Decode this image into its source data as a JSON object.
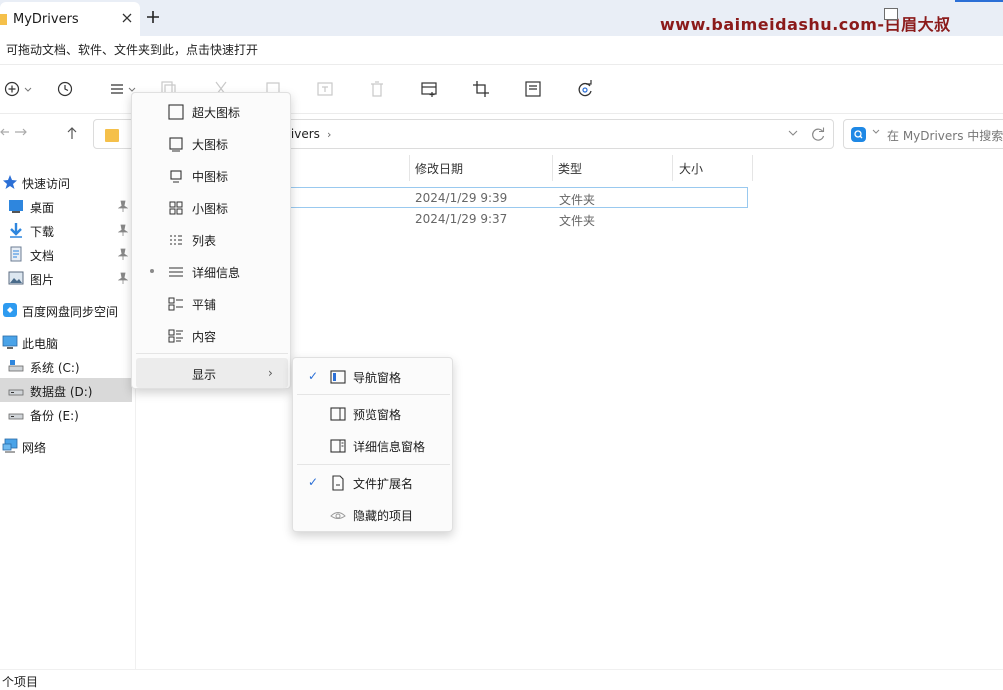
{
  "tab": {
    "title": "MyDrivers"
  },
  "watermark": "www.baimeidashu.com-白眉大叔",
  "hint": "可拖动文档、软件、文件夹到此，点击快速打开",
  "address": {
    "path_tail": "rivers",
    "separator": "›"
  },
  "search": {
    "placeholder": "在 MyDrivers 中搜索"
  },
  "nav": {
    "quick_access": "快速访问",
    "desktop": "桌面",
    "downloads": "下载",
    "documents": "文档",
    "pictures": "图片",
    "baidu": "百度网盘同步空间",
    "this_pc": "此电脑",
    "system_drive": "系统 (C:)",
    "data_drive": "数据盘 (D:)",
    "backup_drive": "备份 (E:)",
    "network": "网络"
  },
  "columns": {
    "modified": "修改日期",
    "type": "类型",
    "size": "大小"
  },
  "rows": [
    {
      "modified": "2024/1/29 9:39",
      "type": "文件夹"
    },
    {
      "modified": "2024/1/29 9:37",
      "type": "文件夹"
    }
  ],
  "status": "个项目",
  "view_menu": {
    "extra_large": "超大图标",
    "large": "大图标",
    "medium": "中图标",
    "small": "小图标",
    "list": "列表",
    "details": "详细信息",
    "tiles": "平铺",
    "content": "内容",
    "show": "显示",
    "selected": "详细信息"
  },
  "show_menu": {
    "nav_pane": "导航窗格",
    "preview_pane": "预览窗格",
    "details_pane": "详细信息窗格",
    "extensions": "文件扩展名",
    "hidden_items": "隐藏的项目",
    "checked": [
      "导航窗格",
      "文件扩展名"
    ]
  },
  "colors": {
    "accent": "#2b6fd6",
    "folder": "#f5c04a",
    "watermark": "#8b1a1a"
  }
}
